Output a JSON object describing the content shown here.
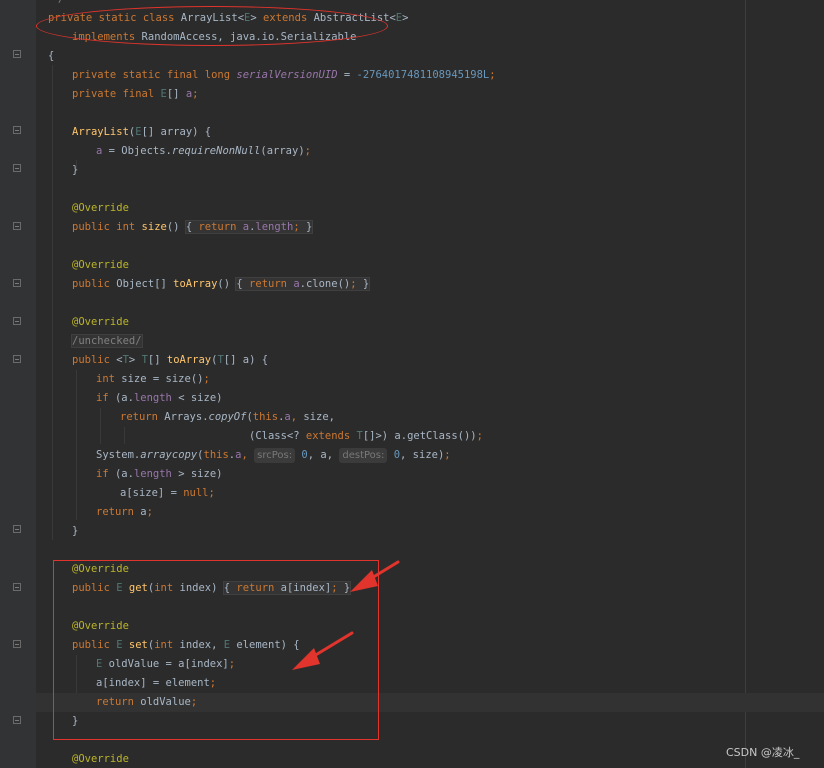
{
  "editor": {
    "lines": {
      "l0_comment": "*/",
      "l1_private": "private",
      "l1_static": "static",
      "l1_class": "class",
      "l1_name": "ArrayList",
      "l1_lt": "<",
      "l1_E": "E",
      "l1_gt": ">",
      "l1_extends": "extends",
      "l1_super": "AbstractList",
      "l1_E2": "E",
      "l2_implements": "implements",
      "l2_ifaces": "RandomAccess, java.io.Serializable",
      "l3_brace": "{",
      "l4_mods": "private static final long",
      "l4_name": "serialVersionUID",
      "l4_eq": " = ",
      "l4_val": "-2764017481108945198L",
      "l4_semi": ";",
      "l5_mods": "private final",
      "l5_E": "E",
      "l5_rest": "[] ",
      "l5_a": "a",
      "l5_semi": ";",
      "l7_ctor": "ArrayList",
      "l7_p1": "(",
      "l7_E": "E",
      "l7_p2": "[] array) {",
      "l8_a": "a",
      "l8_eq": " = Objects.",
      "l8_fn": "requireNonNull",
      "l8_rest": "(array)",
      "l8_semi": ";",
      "l9_brace": "}",
      "l11_ann": "@Override",
      "l12_mods": "public int",
      "l12_fn": "size",
      "l12_paren": "() ",
      "l12_body_open": "{ ",
      "l12_return": "return",
      "l12_a": "a",
      "l12_dot": ".",
      "l12_len": "length",
      "l12_semi": ";",
      "l12_close": " }",
      "l14_ann": "@Override",
      "l15_public": "public",
      "l15_type": " Object[] ",
      "l15_fn": "toArray",
      "l15_paren": "() ",
      "l15_body_open": "{ ",
      "l15_return": "return",
      "l15_a": "a",
      "l15_clone": ".clone()",
      "l15_semi": ";",
      "l15_close": " }",
      "l17_ann": "@Override",
      "l18_cmt": "/unchecked/",
      "l19_public": "public",
      "l19_lt": " <",
      "l19_T": "T",
      "l19_gt": "> ",
      "l19_T2": "T",
      "l19_arr": "[] ",
      "l19_fn": "toArray",
      "l19_p1": "(",
      "l19_T3": "T",
      "l19_p2": "[] a) {",
      "l20_int": "int",
      "l20_rest": " size = size()",
      "l20_semi": ";",
      "l21_if": "if",
      "l21_p": " (a.",
      "l21_len": "length",
      "l21_rest": " < size)",
      "l22_return": "return",
      "l22_arrays": " Arrays.",
      "l22_fn": "copyOf",
      "l22_p": "(",
      "l22_this": "this",
      "l22_dot": ".",
      "l22_a": "a",
      "l22_comma": ", ",
      "l22_size": "size,",
      "l23_p": "(Class<? ",
      "l23_extends": "extends",
      "l23_T": " T",
      "l23_rest": "[]>) a.getClass())",
      "l23_semi": ";",
      "l24_sys": "System.",
      "l24_fn": "arraycopy",
      "l24_p": "(",
      "l24_this": "this",
      "l24_dot": ".",
      "l24_a": "a",
      "l24_comma": ", ",
      "l24_hint1": "srcPos:",
      "l24_zero1": "0",
      "l24_mid": ", a, ",
      "l24_hint2": "destPos:",
      "l24_zero2": "0",
      "l24_end": ", size)",
      "l24_semi": ";",
      "l25_if": "if",
      "l25_p": " (a.",
      "l25_len": "length",
      "l25_rest": " > size)",
      "l26_lhs": "a[size] = ",
      "l26_null": "null",
      "l26_semi": ";",
      "l27_return": "return",
      "l27_rest": " a",
      "l27_semi": ";",
      "l28_brace": "}",
      "l30_ann": "@Override",
      "l31_public": "public",
      "l31_E": " E ",
      "l31_fn": "get",
      "l31_p1": "(",
      "l31_int": "int",
      "l31_p2": " index) ",
      "l31_open": "{ ",
      "l31_return": "return",
      "l31_rest": " a[index]",
      "l31_semi": ";",
      "l31_close": " }",
      "l33_ann": "@Override",
      "l34_public": "public",
      "l34_E": " E ",
      "l34_fn": "set",
      "l34_p1": "(",
      "l34_int": "int",
      "l34_p2": " index, ",
      "l34_E2": "E",
      "l34_p3": " element) {",
      "l35_E": "E",
      "l35_rest": " oldValue = a[index]",
      "l35_semi": ";",
      "l36_rest": "a[index] = element",
      "l36_semi": ";",
      "l37_return": "return",
      "l37_rest": " oldValue",
      "l37_semi": ";",
      "l38_brace": "}",
      "l40_ann": "@Override"
    }
  },
  "watermark": "CSDN @凌冰_"
}
